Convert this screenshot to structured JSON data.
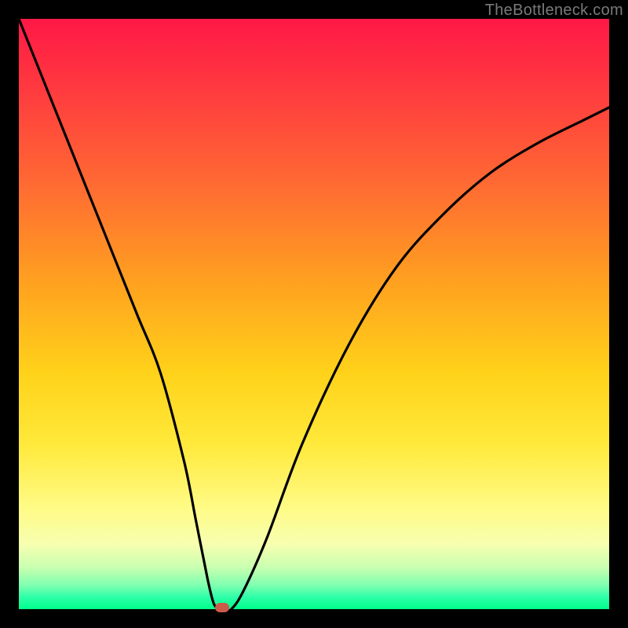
{
  "watermark": {
    "text": "TheBottleneck.com"
  },
  "chart_data": {
    "type": "line",
    "title": "",
    "xlabel": "",
    "ylabel": "",
    "xlim": [
      0,
      100
    ],
    "ylim": [
      0,
      100
    ],
    "grid": false,
    "legend": false,
    "background": "red-to-green vertical gradient (bottleneck severity)",
    "series": [
      {
        "name": "bottleneck-curve",
        "x": [
          0,
          4,
          8,
          12,
          16,
          20,
          24,
          28,
          30,
          32,
          33,
          34,
          35,
          36,
          38,
          42,
          48,
          56,
          64,
          72,
          80,
          88,
          96,
          100
        ],
        "values": [
          100,
          90,
          80,
          70,
          60,
          50,
          40,
          25,
          15,
          5,
          1,
          0,
          0,
          0,
          3,
          12,
          28,
          45,
          58,
          67,
          74,
          79,
          83,
          85
        ]
      }
    ],
    "curve_description": "Sharp V-shaped notch dipping to 0 near x≈34; left branch near-linear from 100→0; right branch concave rising toward ~85.",
    "marker": {
      "x": 34.5,
      "y": 0,
      "color": "#cc5a4a"
    }
  }
}
